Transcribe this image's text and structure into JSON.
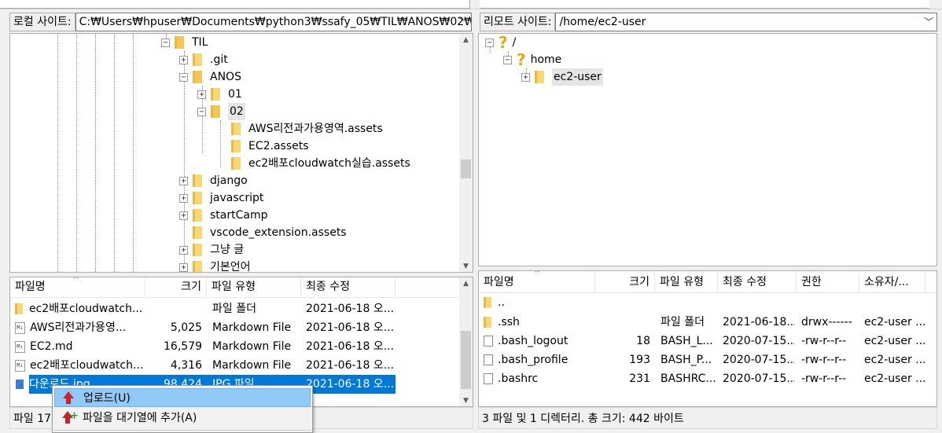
{
  "local": {
    "site_label": "로컬 사이트:",
    "path": "C:₩Users₩hpuser₩Documents₩python3₩ssafy_05₩TIL₩ANOS₩02₩",
    "tree": [
      {
        "label": "TIL",
        "expander": "−"
      },
      {
        "label": ".git",
        "expander": "+"
      },
      {
        "label": "ANOS",
        "expander": "−"
      },
      {
        "label": "01",
        "expander": "+"
      },
      {
        "label": "02",
        "expander": "−"
      },
      {
        "label": "AWS리전과가용영역.assets",
        "expander": ""
      },
      {
        "label": "EC2.assets",
        "expander": ""
      },
      {
        "label": "ec2배포cloudwatch실습.assets",
        "expander": ""
      },
      {
        "label": "django",
        "expander": "+"
      },
      {
        "label": "javascript",
        "expander": "+"
      },
      {
        "label": "startCamp",
        "expander": "+"
      },
      {
        "label": "vscode_extension.assets",
        "expander": ""
      },
      {
        "label": "그냥 글",
        "expander": "+"
      },
      {
        "label": "기본언어",
        "expander": "+"
      }
    ],
    "columns": [
      "파일명",
      "크기",
      "파일 유형",
      "최종 수정"
    ],
    "files": [
      {
        "name": "ec2배포cloudwatch...",
        "size": "",
        "type": "파일 폴더",
        "modified": "2021-06-18 오...",
        "icon": "folder"
      },
      {
        "name": "AWS리전과가용영...",
        "size": "5,025",
        "type": "Markdown File",
        "modified": "2021-06-18 오...",
        "icon": "md"
      },
      {
        "name": "EC2.md",
        "size": "16,579",
        "type": "Markdown File",
        "modified": "2021-06-18 오...",
        "icon": "md"
      },
      {
        "name": "ec2배포cloudwatch...",
        "size": "4,316",
        "type": "Markdown File",
        "modified": "2021-06-18 오...",
        "icon": "md"
      },
      {
        "name": "다운로드.jpg",
        "size": "98,424",
        "type": "JPG 파일",
        "modified": "2021-06-18 오...",
        "icon": "jpg"
      }
    ],
    "status": "파일 17"
  },
  "remote": {
    "site_label": "리모트 사이트:",
    "path": "/home/ec2-user",
    "tree": [
      {
        "label": "/",
        "expander": "−"
      },
      {
        "label": "home",
        "expander": "−"
      },
      {
        "label": "ec2-user",
        "expander": "+"
      }
    ],
    "columns": [
      "파일명",
      "크기",
      "파일 유형",
      "최종 수정",
      "권한",
      "소유자/..."
    ],
    "files": [
      {
        "name": "..",
        "size": "",
        "type": "",
        "modified": "",
        "perm": "",
        "owner": "",
        "icon": "folder"
      },
      {
        "name": ".ssh",
        "size": "",
        "type": "파일 폴더",
        "modified": "2021-06-18...",
        "perm": "drwx------",
        "owner": "ec2-user ...",
        "icon": "folder"
      },
      {
        "name": ".bash_logout",
        "size": "18",
        "type": "BASH_L...",
        "modified": "2020-07-15...",
        "perm": "-rw-r--r--",
        "owner": "ec2-user ...",
        "icon": "file"
      },
      {
        "name": ".bash_profile",
        "size": "193",
        "type": "BASH_P...",
        "modified": "2020-07-15...",
        "perm": "-rw-r--r--",
        "owner": "ec2-user ...",
        "icon": "file"
      },
      {
        "name": ".bashrc",
        "size": "231",
        "type": "BASHRC...",
        "modified": "2020-07-15...",
        "perm": "-rw-r--r--",
        "owner": "ec2-user ...",
        "icon": "file"
      }
    ],
    "status": "3 파일 및 1 디렉터리. 총 크기: 442 바이트"
  },
  "context_menu": {
    "items": [
      "업로드(U)",
      "파일을 대기열에 추가(A)"
    ]
  }
}
